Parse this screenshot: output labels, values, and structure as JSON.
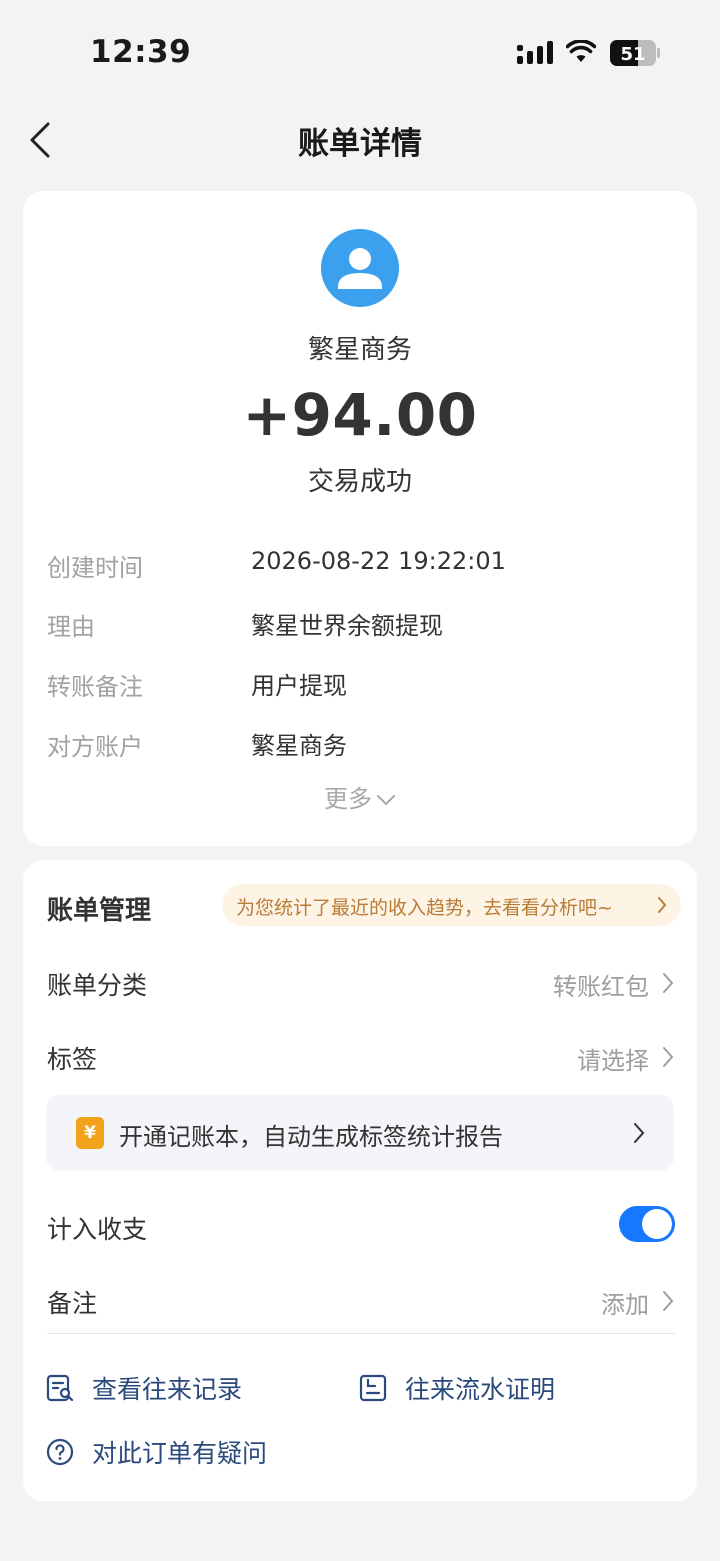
{
  "status_bar": {
    "time": "12:39",
    "battery": "51"
  },
  "nav": {
    "title": "账单详情"
  },
  "transaction": {
    "merchant": "繁星商务",
    "amount": "+94.00",
    "status": "交易成功",
    "details": [
      {
        "label": "创建时间",
        "value": "2026-08-22 19:22:01"
      },
      {
        "label": "理由",
        "value": "繁星世界余额提现"
      },
      {
        "label": "转账备注",
        "value": "用户提现"
      },
      {
        "label": "对方账户",
        "value": "繁星商务"
      }
    ],
    "more_label": "更多"
  },
  "management": {
    "title": "账单管理",
    "tip": "为您统计了最近的收入趋势，去看看分析吧~",
    "category": {
      "label": "账单分类",
      "value": "转账红包"
    },
    "tag": {
      "label": "标签",
      "value": "请选择"
    },
    "promo": {
      "icon_text": "¥",
      "text": "开通记账本，自动生成标签统计报告"
    },
    "include": {
      "label": "计入收支",
      "enabled": true
    },
    "note": {
      "label": "备注",
      "value": "添加"
    },
    "links": {
      "history": "查看往来记录",
      "proof": "往来流水证明",
      "question": "对此订单有疑问"
    }
  },
  "colors": {
    "accent": "#1677ff",
    "avatar": "#3ba1ef",
    "tip_text": "#b97c36",
    "link": "#2a4a7c"
  }
}
